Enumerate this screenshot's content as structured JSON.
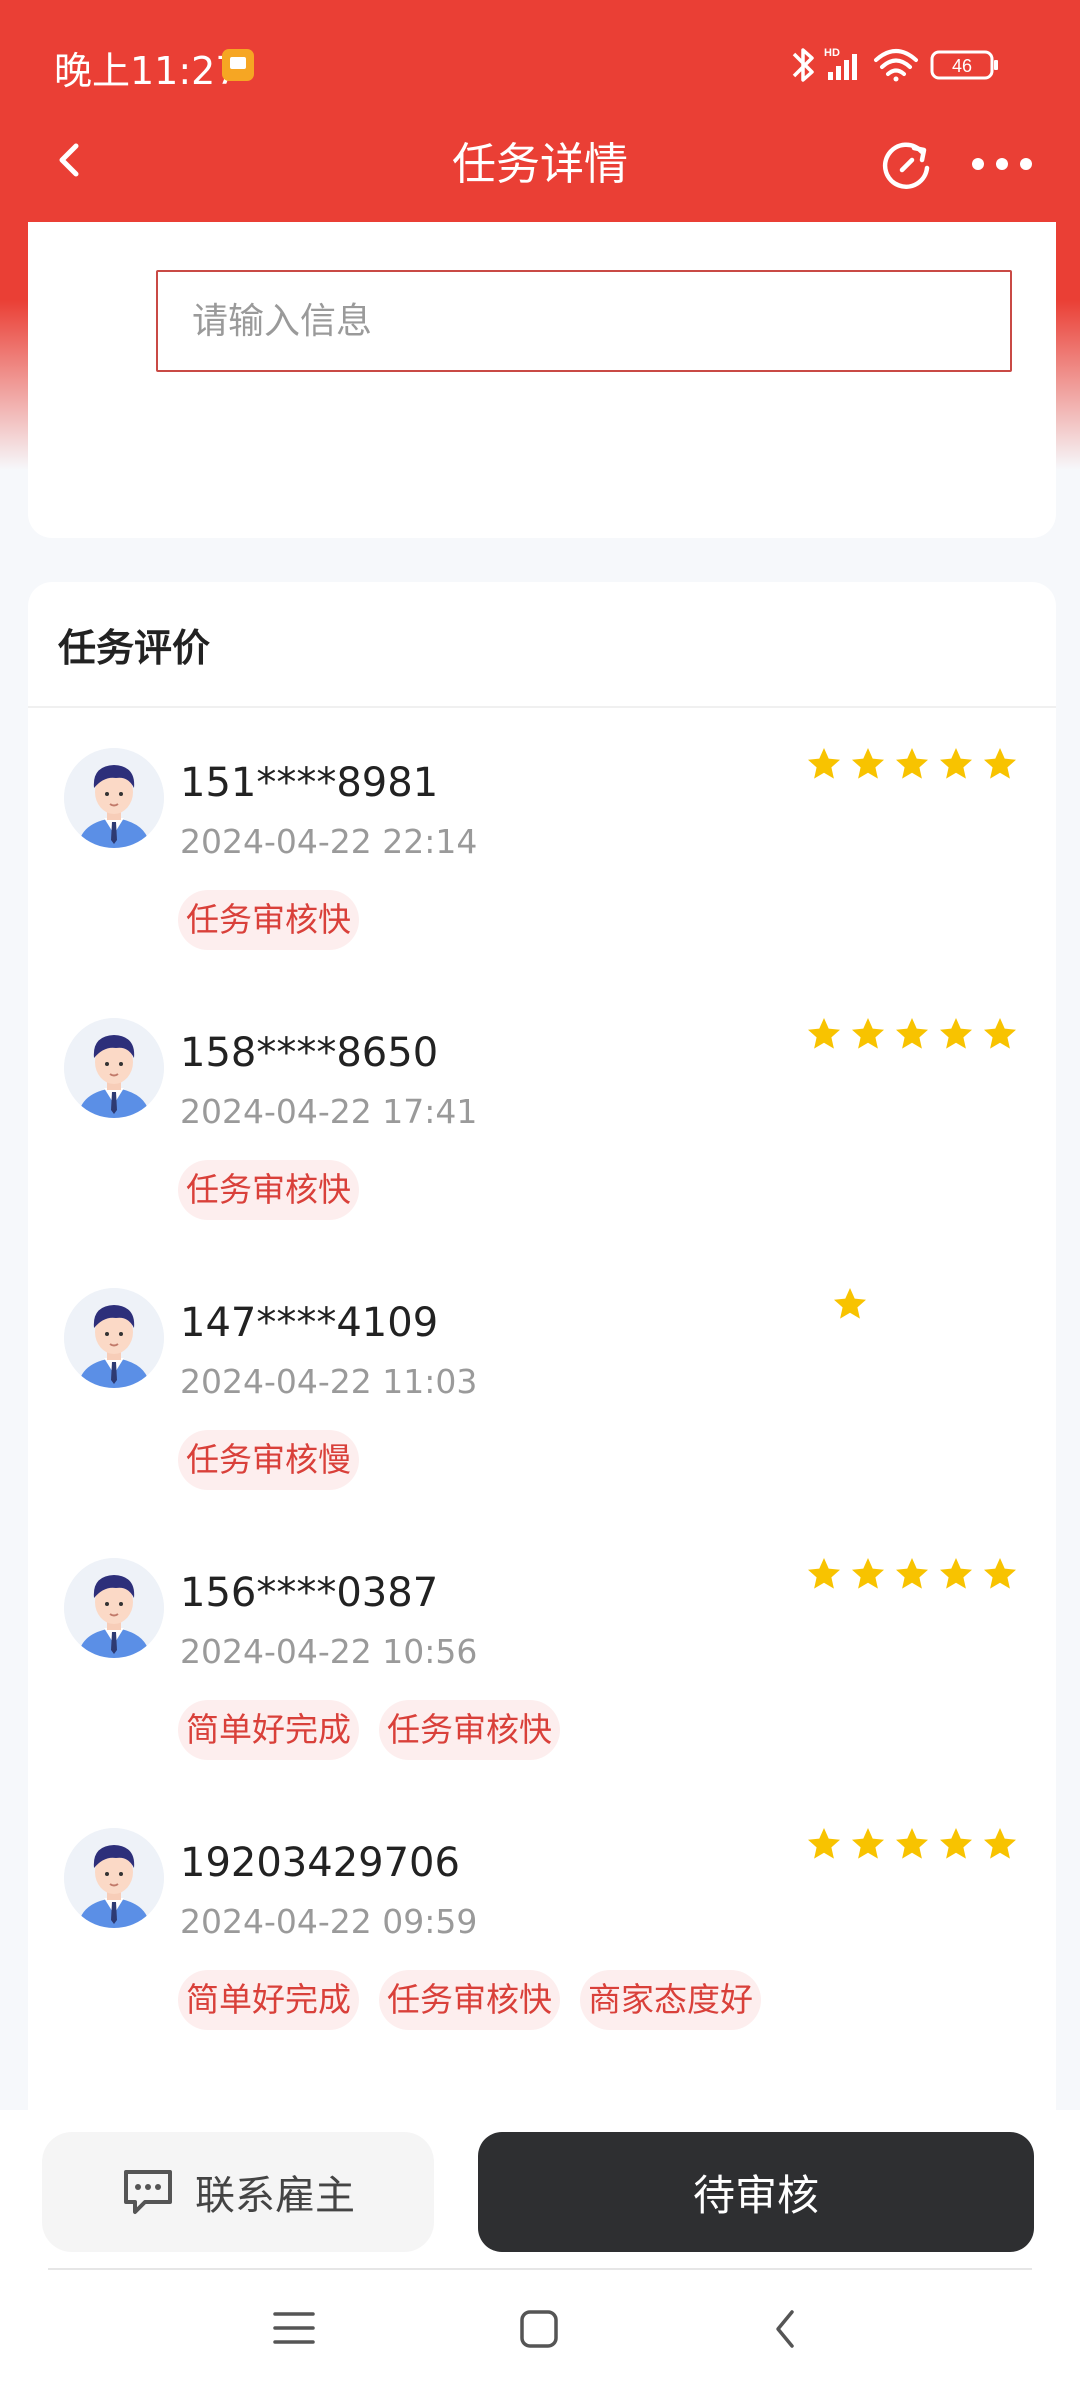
{
  "status_bar": {
    "time": "晚上11:27",
    "battery": "46"
  },
  "nav": {
    "title": "任务详情"
  },
  "input": {
    "placeholder": "请输入信息"
  },
  "reviews": {
    "title": "任务评价",
    "items": [
      {
        "user": "151****8981",
        "time": "2024-04-22 22:14",
        "rating": 5,
        "tags": [
          "任务审核快"
        ]
      },
      {
        "user": "158****8650",
        "time": "2024-04-22 17:41",
        "rating": 5,
        "tags": [
          "任务审核快"
        ]
      },
      {
        "user": "147****4109",
        "time": "2024-04-22 11:03",
        "rating": 1,
        "tags": [
          "任务审核慢"
        ]
      },
      {
        "user": "156****0387",
        "time": "2024-04-22 10:56",
        "rating": 5,
        "tags": [
          "简单好完成",
          "任务审核快"
        ]
      },
      {
        "user": "19203429706",
        "time": "2024-04-22 09:59",
        "rating": 5,
        "tags": [
          "简单好完成",
          "任务审核快",
          "商家态度好"
        ]
      }
    ]
  },
  "bottom": {
    "contact_label": "联系雇主",
    "status_label": "待审核"
  },
  "colors": {
    "brand_red": "#ea3f35",
    "star": "#f8c300",
    "tag_text": "#d9403a",
    "tag_bg": "#fdeeee",
    "dark_button": "#2e2f31"
  },
  "icons": [
    "back-icon",
    "refresh-icon",
    "more-icon",
    "star-icon",
    "chat-icon",
    "menu-icon",
    "home-icon",
    "back-nav-icon"
  ]
}
